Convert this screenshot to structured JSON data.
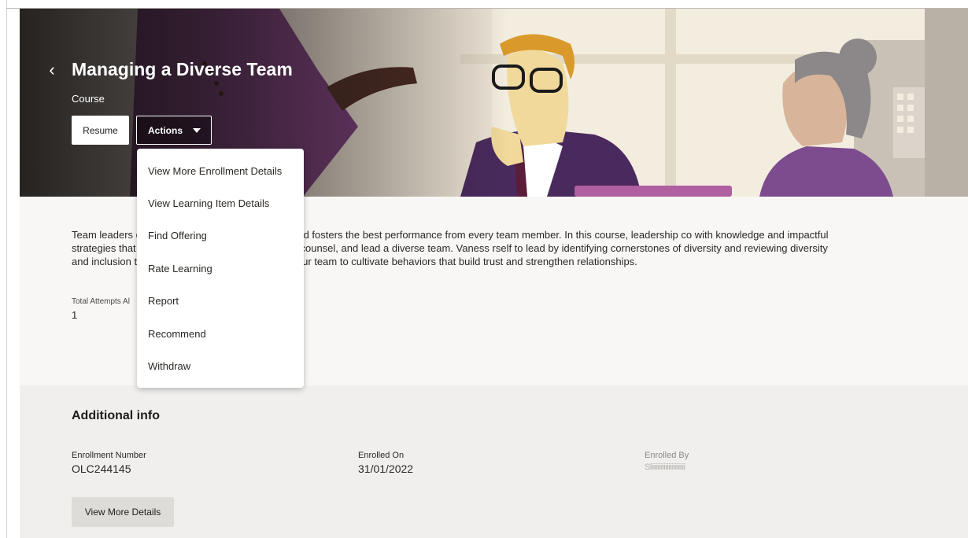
{
  "header": {
    "back_icon": "chevron-left-icon",
    "title": "Managing a Diverse Team",
    "subtitle": "Course",
    "resume_label": "Resume",
    "actions_label": "Actions",
    "actions_icon": "caret-down-icon"
  },
  "actions_menu": {
    "items": [
      {
        "label": "View More Enrollment Details"
      },
      {
        "label": "View Learning Item Details"
      },
      {
        "label": "Find Offering"
      },
      {
        "label": "Rate Learning"
      },
      {
        "label": "Report"
      },
      {
        "label": "Recommend"
      },
      {
        "label": "Withdraw"
      }
    ]
  },
  "description": {
    "text": "Team leaders culture that celebrates differences and fosters the best performance from every team member. In this course, leadership co with knowledge and impactful strategies that can help you successfully manage, counsel, and lead a diverse team. Vaness rself to lead by identifying cornerstones of diversity and reviewing diversity and inclusion terminology. She then shares s ng your team to cultivate behaviors that build trust and strengthen relationships.",
    "attempts_label": "Total Attempts Al",
    "attempts_value": "1"
  },
  "additional_info": {
    "title": "Additional info",
    "enrollment_number_label": "Enrollment Number",
    "enrollment_number_value": "OLC244145",
    "enrolled_on_label": "Enrolled On",
    "enrolled_on_value": "31/01/2022",
    "enrolled_by_label": "Enrolled By",
    "enrolled_by_value": "Sliiiiiiiiiiiiiiiiiiiiii",
    "view_more_label": "View More Details"
  },
  "colors": {
    "page_bg": "#f1efed",
    "description_bg": "#f8f7f5",
    "suit_purple": "#4a2a5e",
    "accent_purple": "#7a3f7e"
  }
}
